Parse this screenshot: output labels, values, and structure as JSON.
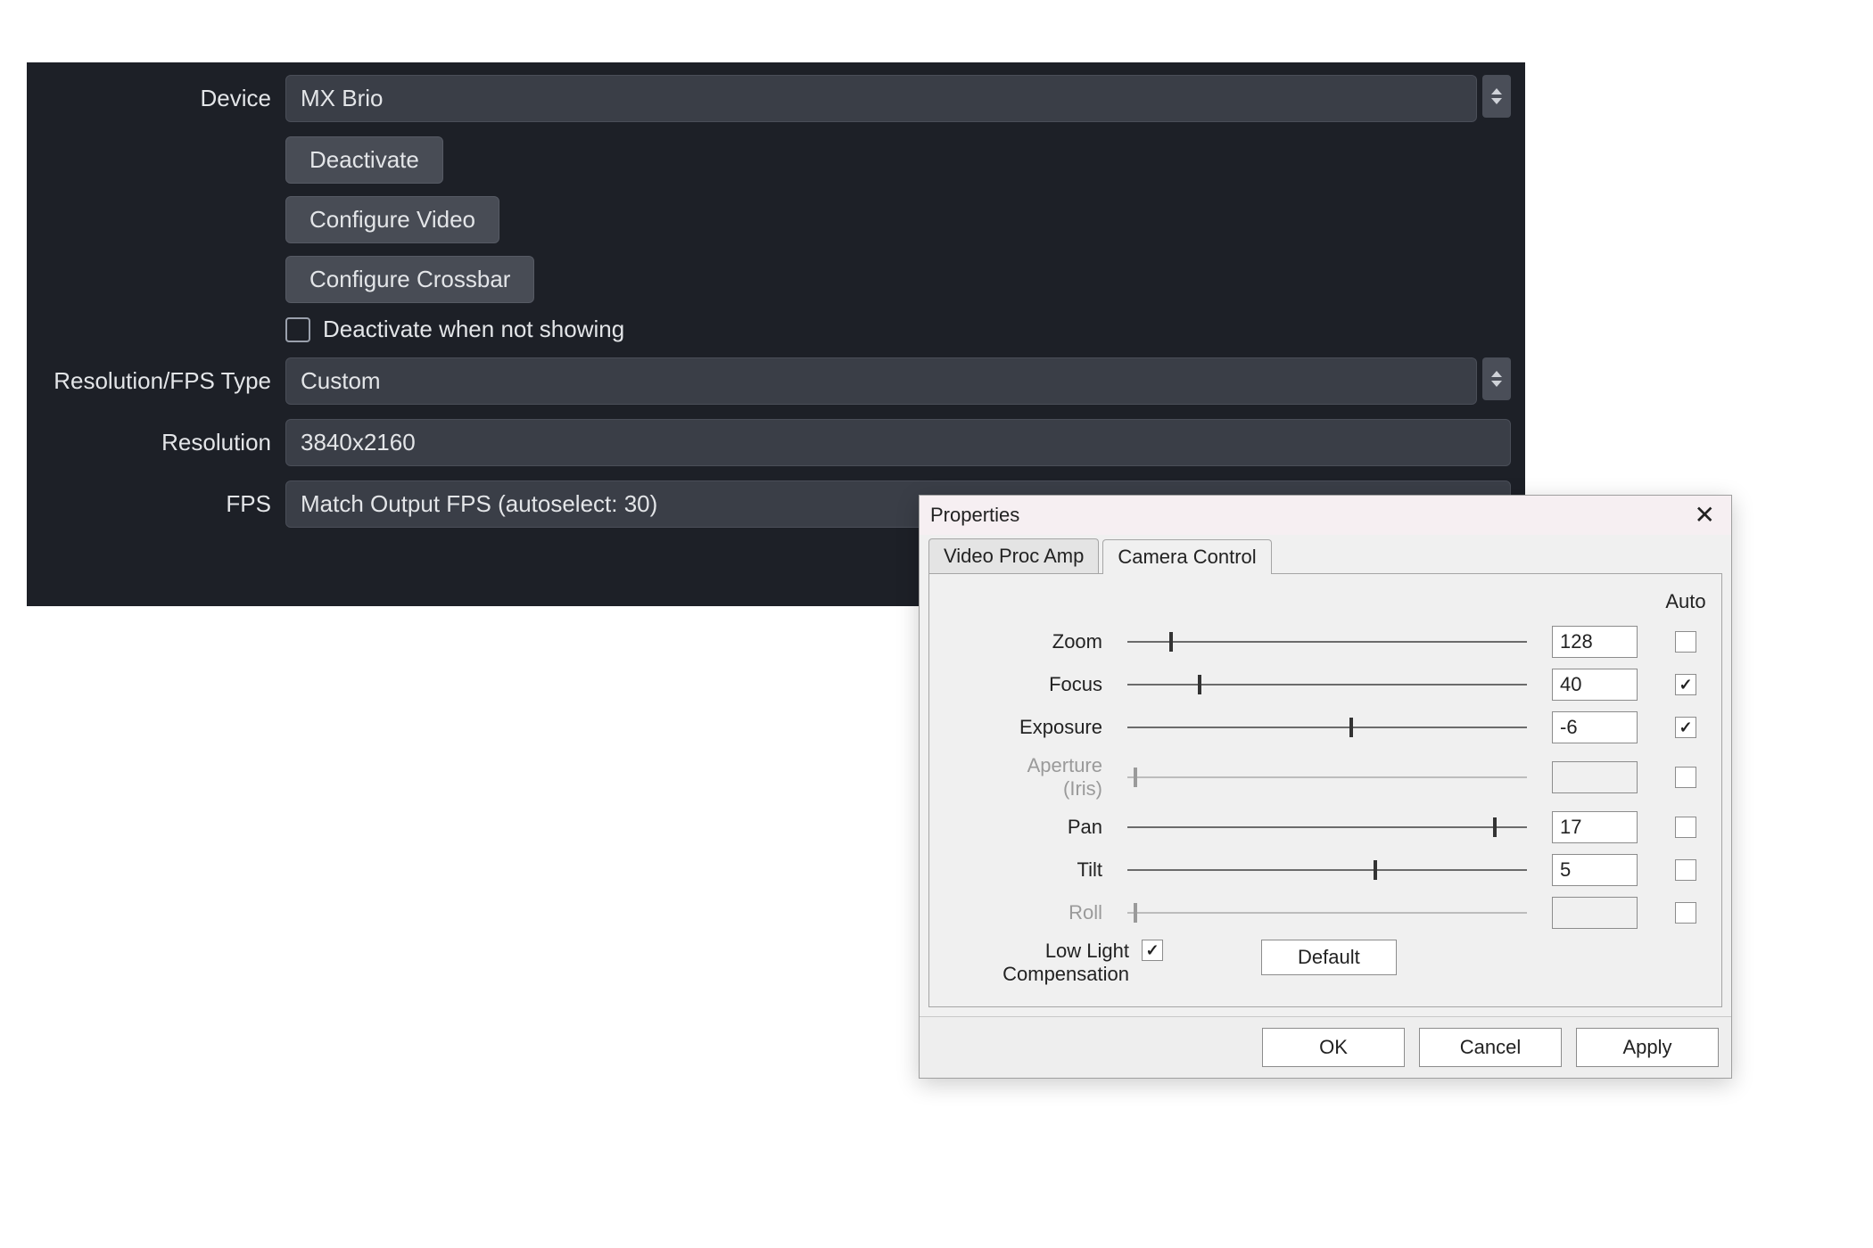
{
  "obs": {
    "labels": {
      "device": "Device",
      "res_type": "Resolution/FPS Type",
      "resolution": "Resolution",
      "fps": "FPS"
    },
    "device_value": "MX Brio",
    "buttons": {
      "deactivate": "Deactivate",
      "configure_video": "Configure Video",
      "configure_crossbar": "Configure Crossbar"
    },
    "checkbox_deactivate_label": "Deactivate when not showing",
    "checkbox_deactivate_checked": false,
    "res_type_value": "Custom",
    "resolution_value": "3840x2160",
    "fps_value": "Match Output FPS (autoselect: 30)"
  },
  "dialog": {
    "title": "Properties",
    "tabs": {
      "video_proc_amp": "Video Proc Amp",
      "camera_control": "Camera Control"
    },
    "auto_header": "Auto",
    "controls": [
      {
        "label": "Zoom",
        "value": "128",
        "pos": 0.11,
        "disabled": false,
        "auto": false
      },
      {
        "label": "Focus",
        "value": "40",
        "pos": 0.18,
        "disabled": false,
        "auto": true
      },
      {
        "label": "Exposure",
        "value": "-6",
        "pos": 0.56,
        "disabled": false,
        "auto": true
      },
      {
        "label": "Aperture\n(Iris)",
        "value": "",
        "pos": 0.02,
        "disabled": true,
        "auto": false
      },
      {
        "label": "Pan",
        "value": "17",
        "pos": 0.92,
        "disabled": false,
        "auto": false
      },
      {
        "label": "Tilt",
        "value": "5",
        "pos": 0.62,
        "disabled": false,
        "auto": false
      },
      {
        "label": "Roll",
        "value": "",
        "pos": 0.02,
        "disabled": true,
        "auto": false
      }
    ],
    "low_light_label": "Low Light\nCompensation",
    "low_light_checked": true,
    "default_button": "Default",
    "buttons": {
      "ok": "OK",
      "cancel": "Cancel",
      "apply": "Apply"
    }
  }
}
